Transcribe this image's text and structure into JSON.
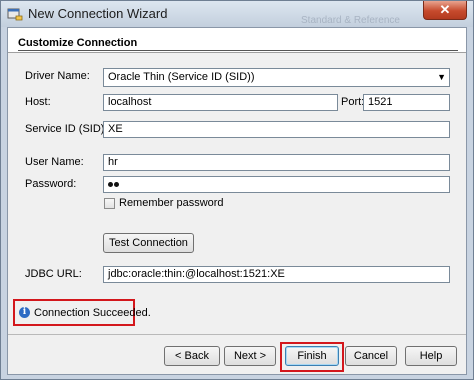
{
  "window": {
    "title": "New Connection Wizard",
    "close_glyph": "✕",
    "title_ghost": "Standard & Reference"
  },
  "form": {
    "section_title": "Customize Connection",
    "driver_label": "Driver Name:",
    "driver_value": "Oracle Thin (Service ID (SID))",
    "host_label": "Host:",
    "host_value": "localhost",
    "port_label": "Port:",
    "port_value": "1521",
    "sid_label": "Service ID (SID):",
    "sid_value": "XE",
    "user_label": "User Name:",
    "user_value": "hr",
    "password_label": "Password:",
    "password_mask_length": 2,
    "remember_label": "Remember password",
    "remember_checked": false,
    "test_button": "Test Connection",
    "jdbc_label": "JDBC URL:",
    "jdbc_value": "jdbc:oracle:thin:@localhost:1521:XE"
  },
  "status": {
    "icon": "info-icon",
    "text": "Connection Succeeded."
  },
  "buttons": {
    "back": "< Back",
    "next": "Next >",
    "finish": "Finish",
    "cancel": "Cancel",
    "help": "Help"
  },
  "colors": {
    "highlight": "#d3171c",
    "close_button": "#c64a2d",
    "info": "#2d6bc4"
  }
}
